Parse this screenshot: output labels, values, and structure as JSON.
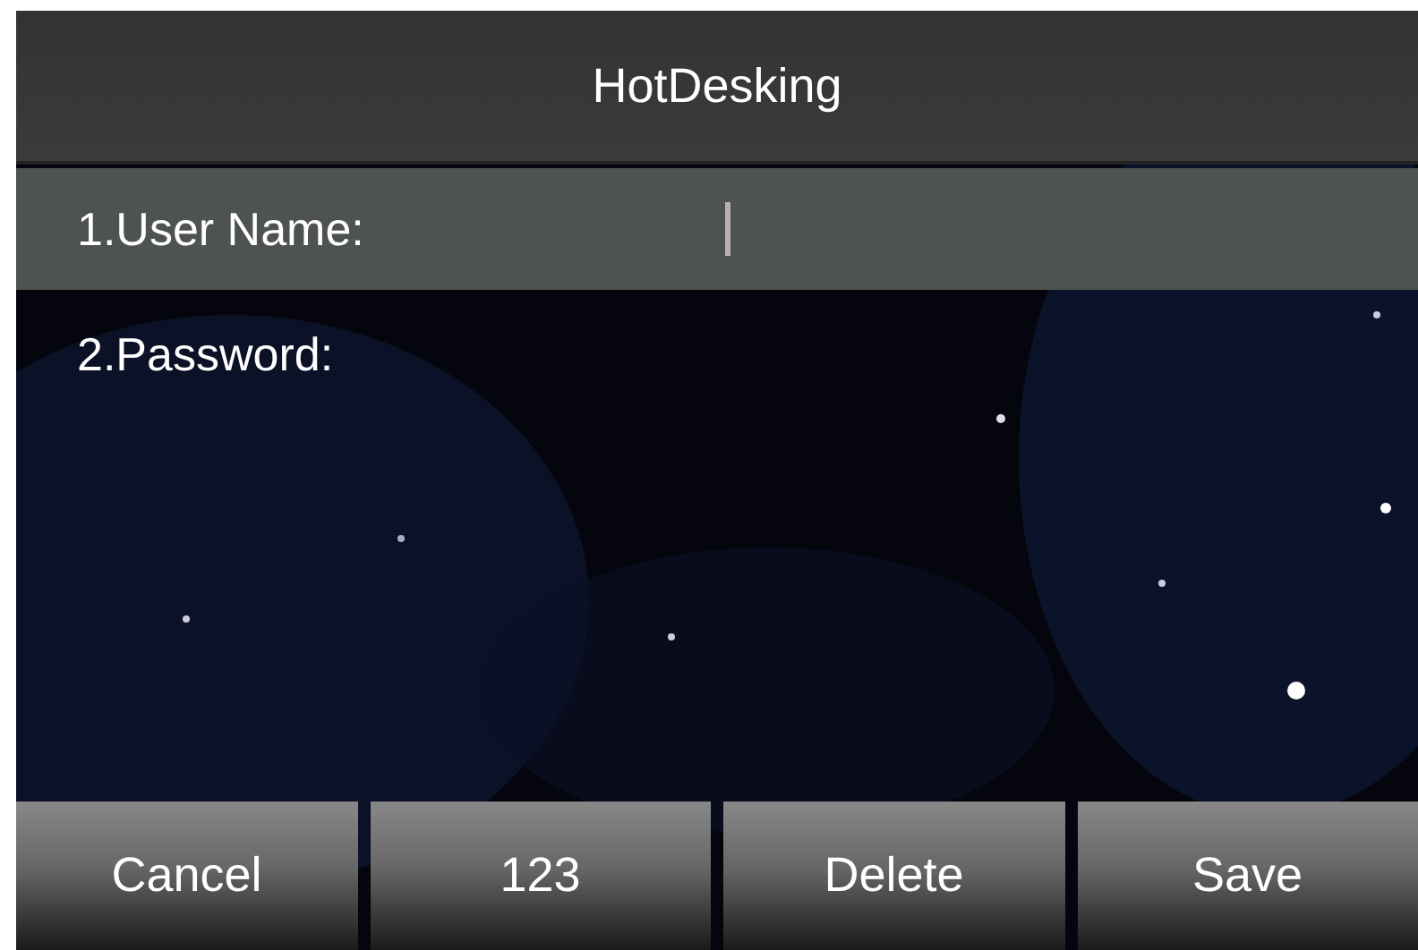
{
  "title": "HotDesking",
  "fields": [
    {
      "label": "1.User Name:",
      "selected": true
    },
    {
      "label": "2.Password:",
      "selected": false
    }
  ],
  "softkeys": [
    "Cancel",
    "123",
    "Delete",
    "Save"
  ]
}
